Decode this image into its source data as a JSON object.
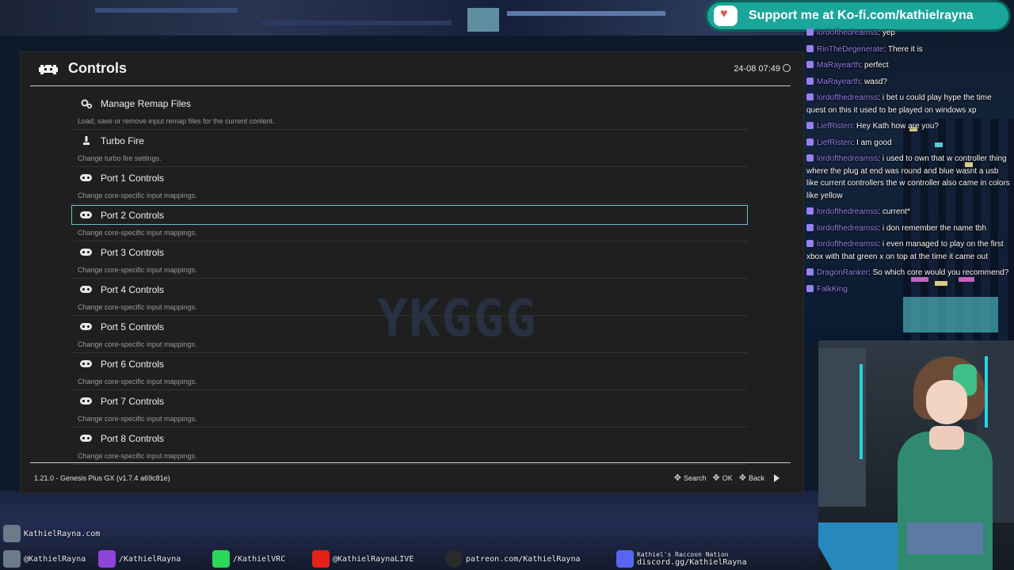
{
  "stream": {
    "kofi": "Support me at Ko-fi.com/kathielrayna"
  },
  "window": {
    "title": "Controls",
    "clock": "24-08 07:49",
    "watermark": "YKGGG"
  },
  "menu": {
    "items": [
      {
        "label": "Manage Remap Files",
        "desc": "Load, save or remove input remap files for the current content.",
        "icon": "gears-icon"
      },
      {
        "label": "Turbo Fire",
        "desc": "Change turbo fire settings.",
        "icon": "joystick-icon"
      },
      {
        "label": "Port 1 Controls",
        "desc": "Change core-specific input mappings.",
        "icon": "gamepad-icon"
      },
      {
        "label": "Port 2 Controls",
        "desc": "Change core-specific input mappings.",
        "icon": "gamepad-icon",
        "selected": true
      },
      {
        "label": "Port 3 Controls",
        "desc": "Change core-specific input mappings.",
        "icon": "gamepad-icon"
      },
      {
        "label": "Port 4 Controls",
        "desc": "Change core-specific input mappings.",
        "icon": "gamepad-icon"
      },
      {
        "label": "Port 5 Controls",
        "desc": "Change core-specific input mappings.",
        "icon": "gamepad-icon"
      },
      {
        "label": "Port 6 Controls",
        "desc": "Change core-specific input mappings.",
        "icon": "gamepad-icon"
      },
      {
        "label": "Port 7 Controls",
        "desc": "Change core-specific input mappings.",
        "icon": "gamepad-icon"
      },
      {
        "label": "Port 8 Controls",
        "desc": "Change core-specific input mappings.",
        "icon": "gamepad-icon"
      }
    ]
  },
  "footer": {
    "version": "1.21.0 - Genesis Plus GX (v1.7.4 a69c81e)",
    "search": "Search",
    "ok": "OK",
    "back": "Back"
  },
  "chat": [
    {
      "user": "lordofthedreamss",
      "color": "#9b7ff0",
      "text": "yep"
    },
    {
      "user": "RinTheDegenerate",
      "color": "#9b7ff0",
      "text": "There it is"
    },
    {
      "user": "MaRayearth",
      "color": "#9b7ff0",
      "text": "perfect"
    },
    {
      "user": "MaRayearth",
      "color": "#9b7ff0",
      "text": "wasd?"
    },
    {
      "user": "lordofthedreamss",
      "color": "#9b7ff0",
      "text": "i bet u could play hype the time quest on this it used to be played on windows xp"
    },
    {
      "user": "LiefRisten",
      "color": "#9b7ff0",
      "text": "Hey Kath how are you?"
    },
    {
      "user": "LiefRisten",
      "color": "#9b7ff0",
      "text": "I am good"
    },
    {
      "user": "lordofthedreamss",
      "color": "#9b7ff0",
      "text": "i used to own that w controller thing where the plug at end was round and blue wasnt a usb like current controllers the w controller also came in colors like yellow"
    },
    {
      "user": "lordofthedreamss",
      "color": "#9b7ff0",
      "text": "current*"
    },
    {
      "user": "lordofthedreamss",
      "color": "#9b7ff0",
      "text": "i don remember the name tbh"
    },
    {
      "user": "lordofthedreamss",
      "color": "#9b7ff0",
      "text": "i even managed to play on the first xbox with that green x on top at the time it came out"
    },
    {
      "user": "DragonRanker",
      "color": "#9b7ff0",
      "text": "So which core would you recommend?"
    },
    {
      "user": "FalkKing",
      "color": "#9b7ff0",
      "text": ""
    }
  ],
  "social": {
    "site": "KathielRayna.com",
    "twitter": "@KathielRayna",
    "twitch": "/KathielRayna",
    "kick": "/KathielVRC",
    "youtube": "@KathielRaynaLIVE",
    "patreon": "patreon.com/KathielRayna",
    "discord_title": "Kathiel's Raccoon Nation",
    "discord": "discord.gg/KathielRayna"
  }
}
